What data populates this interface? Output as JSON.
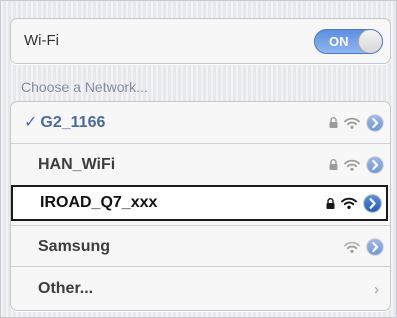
{
  "wifi": {
    "label": "Wi-Fi",
    "toggle_label": "ON"
  },
  "section_header": "Choose a Network...",
  "networks": [
    {
      "checkmark": "✓",
      "name": "G2_1166",
      "suffix": "",
      "locked": true,
      "selected": true
    },
    {
      "name": "HAN_WiFi",
      "suffix": "",
      "locked": true,
      "selected": false
    },
    {
      "name": "IROAD_Q7",
      "suffix": "_xxx",
      "locked": true,
      "selected": false,
      "highlighted": true
    },
    {
      "name": "Samsung",
      "suffix": "",
      "locked": false,
      "selected": false
    },
    {
      "name": "Other...",
      "suffix": "",
      "other": true
    }
  ],
  "colors": {
    "accent_blue": "#4a6a9e",
    "toggle_blue": "#6c9ae6",
    "detail_blue": "#6d97d8",
    "icon_gray": "#9c9c9c"
  },
  "icons": {
    "lock": "lock-icon",
    "wifi": "wifi-icon",
    "detail": "detail-disclosure-icon",
    "chevron": "chevron-right-icon"
  },
  "chevron_glyph": "›"
}
